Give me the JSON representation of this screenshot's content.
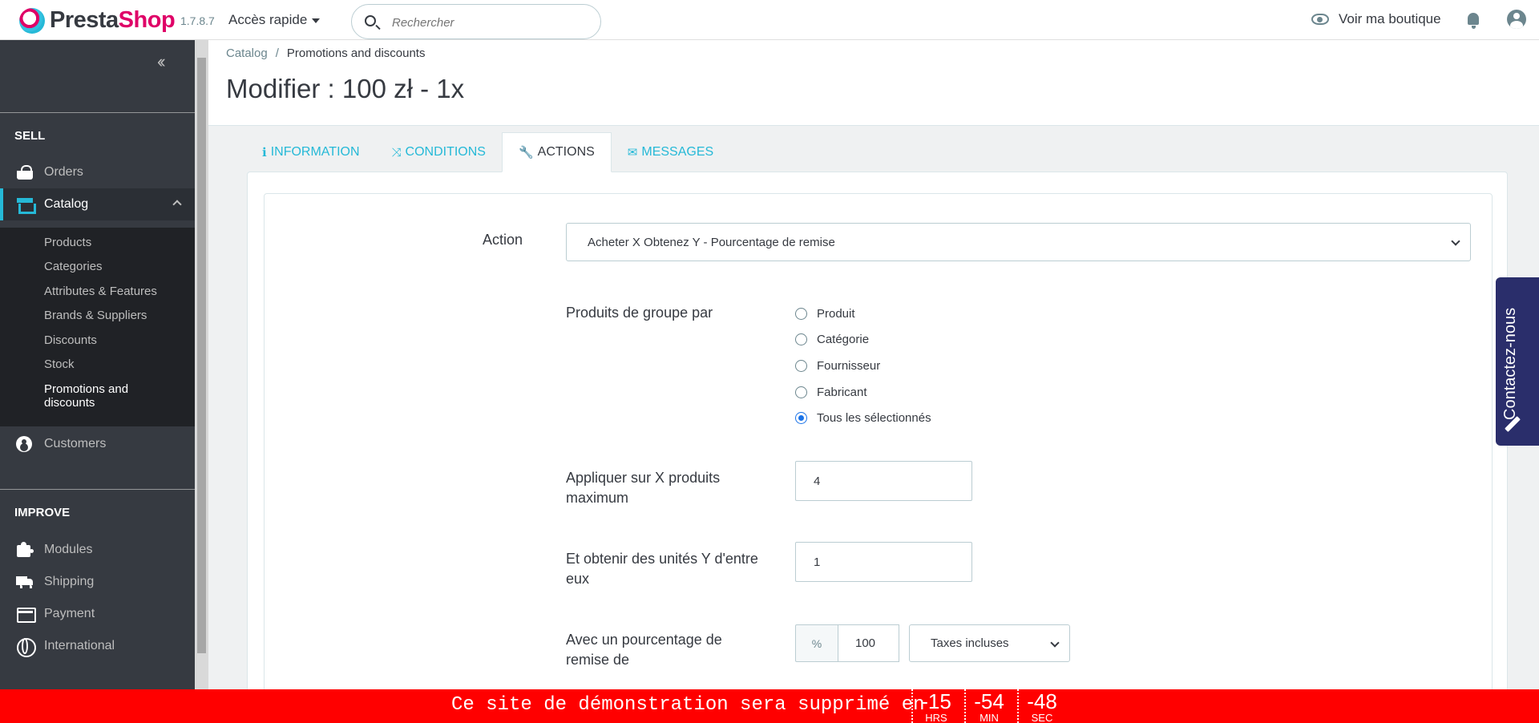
{
  "header": {
    "brand_a": "Presta",
    "brand_b": "Shop",
    "version": "1.7.8.7",
    "quick_access": "Accès rapide",
    "search_placeholder": "Rechercher",
    "view_shop": "Voir ma boutique"
  },
  "sidebar": {
    "sell": "SELL",
    "orders": "Orders",
    "catalog": "Catalog",
    "sub": [
      "Products",
      "Categories",
      "Attributes & Features",
      "Brands & Suppliers",
      "Discounts",
      "Stock",
      "Promotions and discounts"
    ],
    "customers": "Customers",
    "improve": "IMPROVE",
    "modules": "Modules",
    "shipping": "Shipping",
    "payment": "Payment",
    "international": "International"
  },
  "breadcrumb": {
    "root": "Catalog",
    "sep": "/",
    "current": "Promotions and discounts"
  },
  "page_title": "Modifier : 100 zł - 1x",
  "tabs": [
    {
      "label": "INFORMATION",
      "icon": "ℹ"
    },
    {
      "label": "CONDITIONS",
      "icon": "⤨"
    },
    {
      "label": "ACTIONS",
      "icon": "🔧"
    },
    {
      "label": "MESSAGES",
      "icon": "✉"
    }
  ],
  "form": {
    "action_label": "Action",
    "action_value": "Acheter X Obtenez Y - Pourcentage de remise",
    "group_label": "Produits de groupe par",
    "group_options": [
      "Produit",
      "Catégorie",
      "Fournisseur",
      "Fabricant",
      "Tous les sélectionnés"
    ],
    "group_selected": "Tous les sélectionnés",
    "x_label": "Appliquer sur X produits maximum",
    "x_value": "4",
    "y_label": "Et obtenir des unités Y d'entre eux",
    "y_value": "1",
    "pct_label": "Avec un pourcentage de remise de",
    "pct_addon": "%",
    "pct_value": "100",
    "tax_value": "Taxes incluses"
  },
  "contact": "Contactez-nous",
  "demo": {
    "message": "Ce site de démonstration sera supprimé en",
    "hrs": "-15",
    "hrs_unit": "HRS",
    "min": "-54",
    "min_unit": "MIN",
    "sec": "-48",
    "sec_unit": "SEC"
  },
  "colors": {
    "accent": "#25b9d7",
    "sidebar": "#363a41",
    "demo_bar": "#ff0000",
    "brand_pink": "#df0067"
  }
}
